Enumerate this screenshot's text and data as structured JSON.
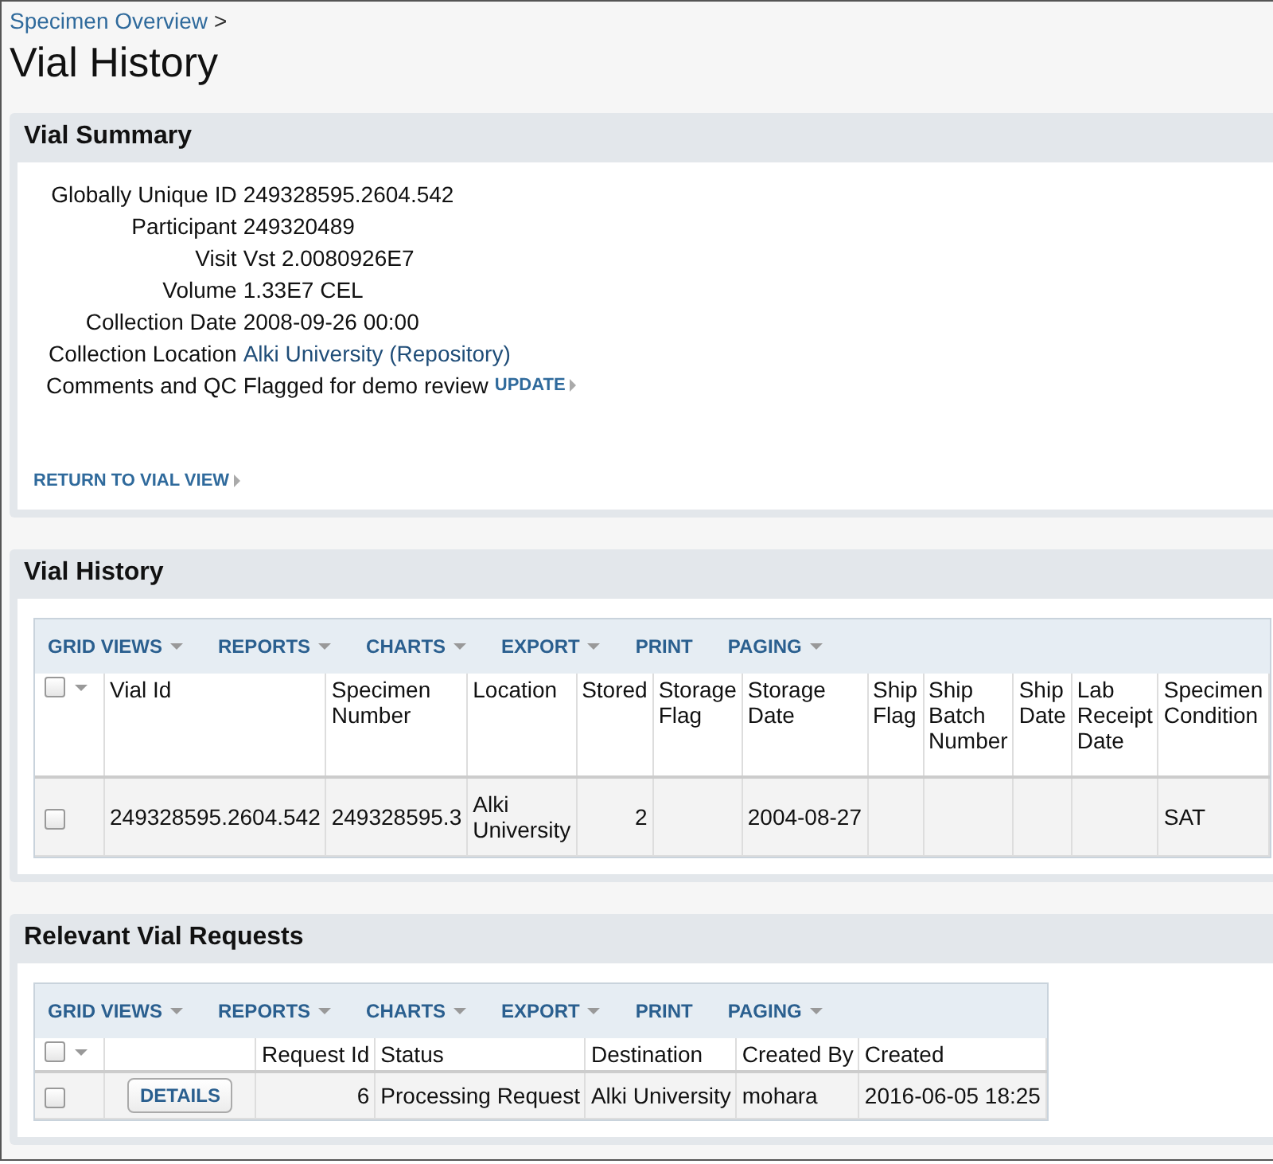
{
  "breadcrumb": {
    "link": "Specimen Overview",
    "separator": ">"
  },
  "page_title": "Vial History",
  "vial_summary": {
    "title": "Vial Summary",
    "fields": [
      {
        "label": "Globally Unique ID",
        "value": "249328595.2604.542",
        "kind": "text"
      },
      {
        "label": "Participant",
        "value": "249320489",
        "kind": "text"
      },
      {
        "label": "Visit",
        "value": "Vst 2.0080926E7",
        "kind": "text"
      },
      {
        "label": "Volume",
        "value": "1.33E7 CEL",
        "kind": "text"
      },
      {
        "label": "Collection Date",
        "value": "2008-09-26 00:00",
        "kind": "text"
      },
      {
        "label": "Collection Location",
        "value": "Alki University (Repository)",
        "kind": "link"
      },
      {
        "label": "Comments and QC",
        "value": "Flagged for demo review",
        "kind": "text",
        "action": "UPDATE"
      }
    ],
    "return_link": "RETURN TO VIAL VIEW"
  },
  "grids": [
    {
      "title": "Vial History",
      "toolbar": [
        {
          "label": "GRID VIEWS",
          "menu": true
        },
        {
          "label": "REPORTS",
          "menu": true
        },
        {
          "label": "CHARTS",
          "menu": true
        },
        {
          "label": "EXPORT",
          "menu": true
        },
        {
          "label": "PRINT",
          "menu": false
        },
        {
          "label": "PAGING",
          "menu": true
        }
      ],
      "all_selected": false,
      "columns": [
        {
          "label": "Vial Id",
          "kind": "text"
        },
        {
          "label": "Specimen Number",
          "kind": "text"
        },
        {
          "label": "Location",
          "kind": "text"
        },
        {
          "label": "Stored",
          "kind": "number"
        },
        {
          "label": "Storage Flag",
          "kind": "text"
        },
        {
          "label": "Storage Date",
          "kind": "text"
        },
        {
          "label": "Ship Flag",
          "kind": "text"
        },
        {
          "label": "Ship Batch Number",
          "kind": "text"
        },
        {
          "label": "Ship Date",
          "kind": "text"
        },
        {
          "label": "Lab Receipt Date",
          "kind": "text"
        },
        {
          "label": "Specimen Condition",
          "kind": "text"
        }
      ],
      "rows": [
        {
          "selected": false,
          "cells": [
            "249328595.2604.542",
            "249328595.3",
            "Alki University",
            "2",
            null,
            "2004-08-27",
            null,
            null,
            null,
            null,
            "SAT"
          ]
        }
      ]
    },
    {
      "title": "Relevant Vial Requests",
      "toolbar": [
        {
          "label": "GRID VIEWS",
          "menu": true
        },
        {
          "label": "REPORTS",
          "menu": true
        },
        {
          "label": "CHARTS",
          "menu": true
        },
        {
          "label": "EXPORT",
          "menu": true
        },
        {
          "label": "PRINT",
          "menu": false
        },
        {
          "label": "PAGING",
          "menu": true
        }
      ],
      "all_selected": false,
      "columns": [
        {
          "kind": "action"
        },
        {
          "label": "Request Id",
          "kind": "number"
        },
        {
          "label": "Status",
          "kind": "text"
        },
        {
          "label": "Destination",
          "kind": "text"
        },
        {
          "label": "Created By",
          "kind": "text"
        },
        {
          "label": "Created",
          "kind": "text"
        }
      ],
      "rows": [
        {
          "selected": false,
          "button": "DETAILS",
          "cells": [
            null,
            "6",
            "Processing Request",
            "Alki University",
            "mohara",
            "2016-06-05 18:25"
          ]
        }
      ]
    }
  ]
}
